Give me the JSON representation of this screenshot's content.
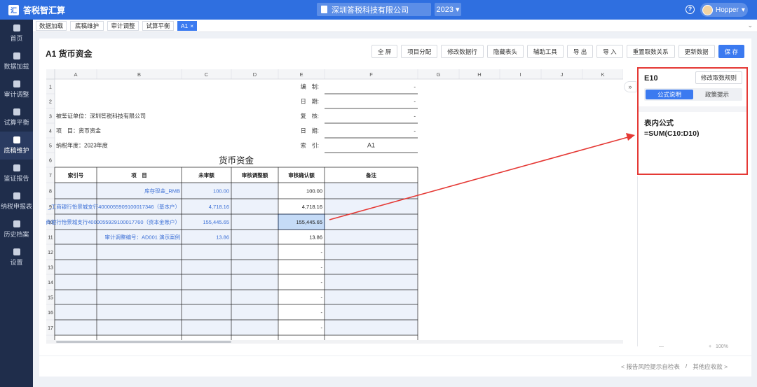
{
  "app": {
    "name": "答税智汇算",
    "logo_text": "汇"
  },
  "header": {
    "company": "深圳答税科技有限公司",
    "year": "2023",
    "user": "Hopper",
    "help_glyph": "?",
    "caret": "▾"
  },
  "sidebar": {
    "items": [
      {
        "label": "首页",
        "icon": "home-icon"
      },
      {
        "label": "数据加载",
        "icon": "database-icon"
      },
      {
        "label": "审计调整",
        "icon": "adjust-icon"
      },
      {
        "label": "试算平衡",
        "icon": "balance-icon"
      },
      {
        "label": "底稿维护",
        "icon": "document-icon",
        "active": true
      },
      {
        "label": "鉴证报告",
        "icon": "report-icon"
      },
      {
        "label": "纳税申报表",
        "icon": "monitor-icon"
      },
      {
        "label": "历史档案",
        "icon": "folder-icon"
      },
      {
        "label": "设置",
        "icon": "gear-icon"
      }
    ]
  },
  "tabs": [
    {
      "label": "数据加载"
    },
    {
      "label": "底稿维护"
    },
    {
      "label": "审计调整"
    },
    {
      "label": "试算平衡"
    },
    {
      "label": "A1",
      "active": true,
      "closable": "×"
    }
  ],
  "tab_collapse": "⌄",
  "page": {
    "title": "A1 货币资金"
  },
  "toolbar": [
    {
      "label": "全 屏"
    },
    {
      "label": "项目分配"
    },
    {
      "label": "修改数据行"
    },
    {
      "label": "隐藏表头"
    },
    {
      "label": "辅助工具"
    },
    {
      "label": "导 出"
    },
    {
      "label": "导 入"
    },
    {
      "label": "重置取数关系"
    },
    {
      "label": "更新数据"
    },
    {
      "label": "保 存",
      "primary": true
    }
  ],
  "sheet": {
    "col_letters": [
      "A",
      "B",
      "C",
      "D",
      "E",
      "F",
      "G",
      "H",
      "I",
      "J",
      "K"
    ],
    "row_numbers": [
      "1",
      "2",
      "3",
      "4",
      "5",
      "6",
      "7",
      "8",
      "9",
      "10",
      "11",
      "12",
      "13",
      "14",
      "15",
      "16",
      "17"
    ],
    "header_rows": {
      "r1_label": "编　制:",
      "r1_value": "-",
      "r2_label": "日　期:",
      "r2_value": "-",
      "r3_left": "被鉴证单位：深圳答税科技有限公司",
      "r3_label": "复　核:",
      "r3_value": "-",
      "r4_left": "项　目：货币资金",
      "r4_label": "日　期:",
      "r4_value": "-",
      "r5_left": "纳税年度：2023年度",
      "r5_label": "索　引:",
      "r5_value": "A1",
      "r6_title": "货币资金"
    },
    "columns": [
      "索引号",
      "项　目",
      "未审额",
      "审核调整额",
      "审核确认额",
      "备注"
    ],
    "rows": [
      {
        "item": "库存现金_RMB",
        "unaudited": "100.00",
        "adjust": "",
        "confirmed": "100.00"
      },
      {
        "item": "_工商银行怡景城支行4000055909100017346（基本户）",
        "unaudited": "4,718.16",
        "adjust": "",
        "confirmed": "4,718.16"
      },
      {
        "item": "商银行怡景城支行4000055929100017760（资本金账户）",
        "unaudited": "155,445.65",
        "adjust": "",
        "confirmed": "155,445.65"
      },
      {
        "item": "审计调整编号：AD001 演示案例",
        "unaudited": "13.86",
        "adjust": "",
        "confirmed": "13.86"
      }
    ],
    "empty_dash": "-",
    "selected_cell": "E10"
  },
  "panel": {
    "cell_ref": "E10",
    "rule_button": "修改取数规则",
    "tabs": [
      {
        "label": "公式说明",
        "active": true
      },
      {
        "label": "政策提示"
      }
    ],
    "formula_heading": "表内公式",
    "formula": "=SUM(C10:D10)",
    "toggle_glyph": "»"
  },
  "footer": {
    "prev": "< 报告风险提示自检表",
    "sep": "/",
    "next": "其他应收款 >"
  },
  "zoom": {
    "minus": "—",
    "plus": "+",
    "value": "100%"
  },
  "colors": {
    "accent": "#3b7af0",
    "topbar": "#2f6fe0",
    "sidebar": "#1f2d4b",
    "link_text": "#3b6fd6",
    "input_fill": "#edf2fb",
    "selected_fill": "#c5dbf7",
    "annotation": "#e53935"
  }
}
